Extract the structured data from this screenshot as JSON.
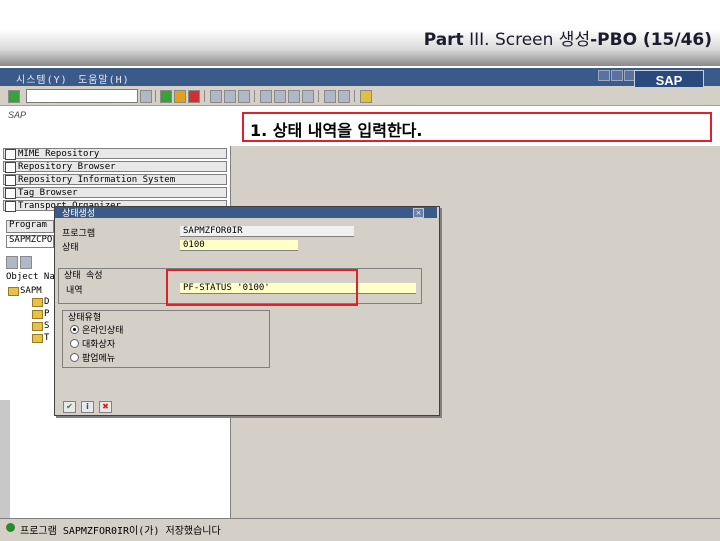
{
  "slide": {
    "title_bold": "Part",
    "title_regular": " III. Screen 생성",
    "title_bold2": "-PBO (15/46)"
  },
  "sap": {
    "menu": [
      "시스템(Y)",
      "도움말(H)"
    ],
    "logo": "SAP",
    "app_label": "SAP",
    "callout_text": "1. 상태 내역을 입력한다."
  },
  "nav": {
    "buttons": [
      "MIME Repository",
      "Repository Browser",
      "Repository Information System",
      "Tag Browser",
      "Transport Organizer"
    ],
    "program_label": "Program",
    "program_value": "SAPMZCPO",
    "object_label": "Object Na"
  },
  "tree": {
    "root": "SAPM",
    "children": [
      "D",
      "P",
      "S",
      "T"
    ]
  },
  "dialog": {
    "title": "상태생성",
    "close": "×",
    "program_label": "프로그램",
    "program_value": "SAPMZFOR0IR",
    "status_label": "상태",
    "status_value": "0100",
    "attr_group_label": "상태 속성",
    "text_label": "내역",
    "text_value": "PF-STATUS '0100'",
    "type_group_label": "상태유형",
    "types": [
      "온라인상태",
      "대화상자",
      "팝업메뉴"
    ],
    "selected_type_index": 0,
    "buttons": [
      "✔",
      "i",
      "✖"
    ]
  },
  "status": {
    "message": "프로그램 SAPMZFOR0IR이(가) 저장했습니다"
  },
  "colors": {
    "highlight": "#e0202a",
    "titlebar": "#3a5a8a"
  }
}
